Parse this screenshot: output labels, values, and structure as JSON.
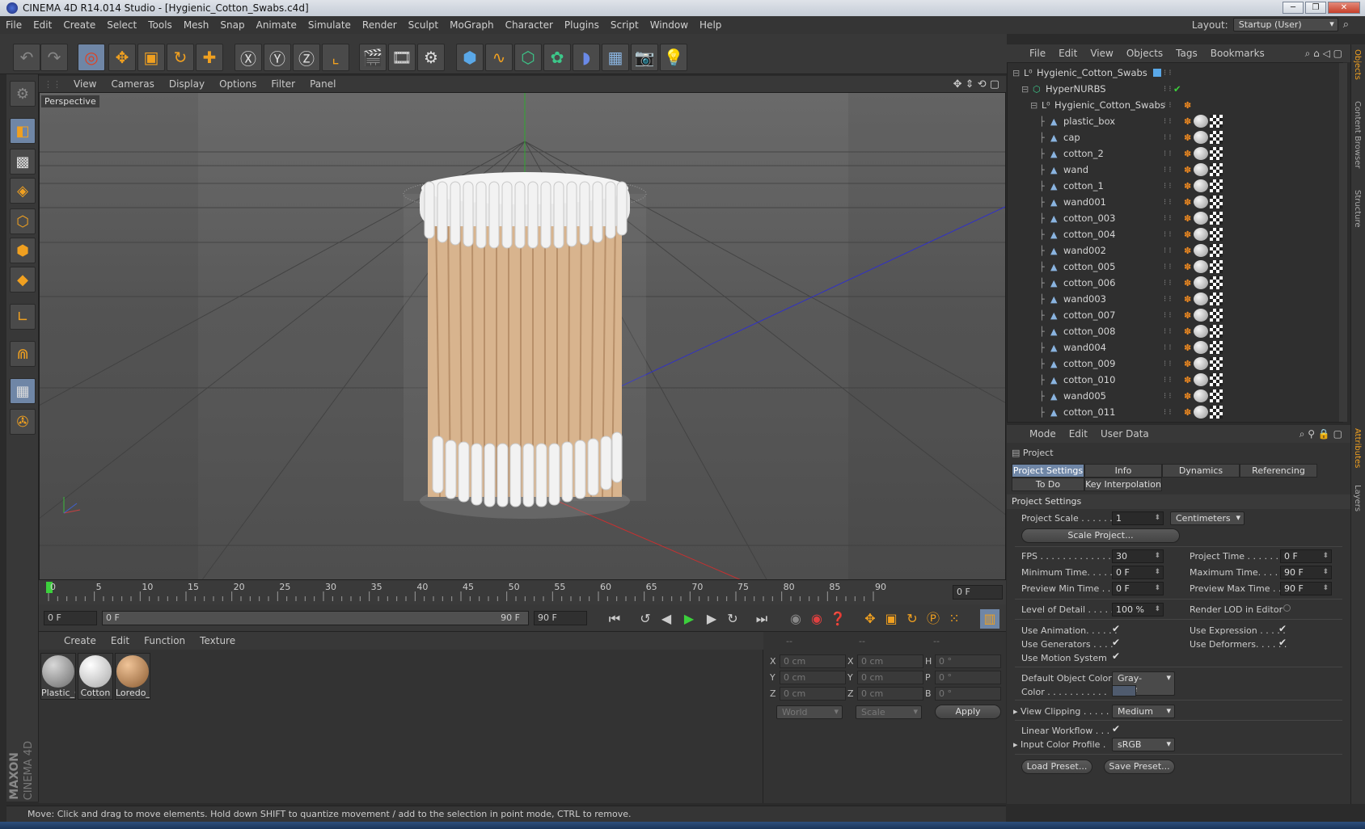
{
  "window": {
    "title": "CINEMA 4D R14.014 Studio - [Hygienic_Cotton_Swabs.c4d]"
  },
  "menu": [
    "File",
    "Edit",
    "Create",
    "Select",
    "Tools",
    "Mesh",
    "Snap",
    "Animate",
    "Simulate",
    "Render",
    "Sculpt",
    "MoGraph",
    "Character",
    "Plugins",
    "Script",
    "Window",
    "Help"
  ],
  "layout": {
    "label": "Layout:",
    "value": "Startup (User)"
  },
  "viewport": {
    "menu": [
      "View",
      "Cameras",
      "Display",
      "Options",
      "Filter",
      "Panel"
    ],
    "label": "Perspective"
  },
  "timeline": {
    "ticks": [
      "0",
      "5",
      "10",
      "15",
      "20",
      "25",
      "30",
      "35",
      "40",
      "45",
      "50",
      "55",
      "60",
      "65",
      "70",
      "75",
      "80",
      "85",
      "90"
    ],
    "current_frame_field": "0 F",
    "start_field": "0 F",
    "range_start": "0 F",
    "range_end": "90 F",
    "end_field": "90 F"
  },
  "materials": {
    "menu": [
      "Create",
      "Edit",
      "Function",
      "Texture"
    ],
    "items": [
      {
        "name": "Plastic_C",
        "color": "#9a9a9a"
      },
      {
        "name": "Cotton",
        "color": "#e8e8e8"
      },
      {
        "name": "Loredo_",
        "color": "#c8905a"
      }
    ]
  },
  "coords": {
    "headers": [
      "--",
      "--",
      "--"
    ],
    "rows": [
      {
        "a": "X",
        "av": "0 cm",
        "b": "X",
        "bv": "0 cm",
        "c": "H",
        "cv": "0 °"
      },
      {
        "a": "Y",
        "av": "0 cm",
        "b": "Y",
        "bv": "0 cm",
        "c": "P",
        "cv": "0 °"
      },
      {
        "a": "Z",
        "av": "0 cm",
        "b": "Z",
        "bv": "0 cm",
        "c": "B",
        "cv": "0 °"
      }
    ],
    "world": "World",
    "scale": "Scale",
    "apply": "Apply"
  },
  "status": "Move: Click and drag to move elements. Hold down SHIFT to quantize movement / add to the selection in point mode, CTRL to remove.",
  "objects": {
    "menu": [
      "File",
      "Edit",
      "View",
      "Objects",
      "Tags",
      "Bookmarks"
    ],
    "tree": [
      {
        "name": "Hygienic_Cotton_Swabs",
        "indent": 0,
        "icon": "null"
      },
      {
        "name": "HyperNURBS",
        "indent": 1,
        "icon": "nurbs"
      },
      {
        "name": "Hygienic_Cotton_Swabs",
        "indent": 2,
        "icon": "null"
      },
      {
        "name": "plastic_box",
        "indent": 3,
        "icon": "poly"
      },
      {
        "name": "cap",
        "indent": 3,
        "icon": "poly"
      },
      {
        "name": "cotton_2",
        "indent": 3,
        "icon": "poly"
      },
      {
        "name": "wand",
        "indent": 3,
        "icon": "poly"
      },
      {
        "name": "cotton_1",
        "indent": 3,
        "icon": "poly"
      },
      {
        "name": "wand001",
        "indent": 3,
        "icon": "poly"
      },
      {
        "name": "cotton_003",
        "indent": 3,
        "icon": "poly"
      },
      {
        "name": "cotton_004",
        "indent": 3,
        "icon": "poly"
      },
      {
        "name": "wand002",
        "indent": 3,
        "icon": "poly"
      },
      {
        "name": "cotton_005",
        "indent": 3,
        "icon": "poly"
      },
      {
        "name": "cotton_006",
        "indent": 3,
        "icon": "poly"
      },
      {
        "name": "wand003",
        "indent": 3,
        "icon": "poly"
      },
      {
        "name": "cotton_007",
        "indent": 3,
        "icon": "poly"
      },
      {
        "name": "cotton_008",
        "indent": 3,
        "icon": "poly"
      },
      {
        "name": "wand004",
        "indent": 3,
        "icon": "poly"
      },
      {
        "name": "cotton_009",
        "indent": 3,
        "icon": "poly"
      },
      {
        "name": "cotton_010",
        "indent": 3,
        "icon": "poly"
      },
      {
        "name": "wand005",
        "indent": 3,
        "icon": "poly"
      },
      {
        "name": "cotton_011",
        "indent": 3,
        "icon": "poly"
      }
    ]
  },
  "right_tabs": [
    "Objects",
    "Content Browser",
    "Structure",
    "Attributes",
    "Layers"
  ],
  "attributes": {
    "menu": [
      "Mode",
      "Edit",
      "User Data"
    ],
    "header": "Project",
    "tabs_row1": [
      "Project Settings",
      "Info",
      "Dynamics",
      "Referencing"
    ],
    "tabs_row2": [
      "To Do",
      "Key Interpolation"
    ],
    "section": "Project Settings",
    "project_scale_label": "Project Scale . . . . . .",
    "project_scale_value": "1",
    "project_scale_unit": "Centimeters",
    "scale_project_btn": "Scale Project...",
    "fps_label": "FPS . . . . . . . . . . . . . .",
    "fps_value": "30",
    "project_time_label": "Project Time . . . . . . .",
    "project_time_value": "0 F",
    "min_time_label": "Minimum Time. . . . . .",
    "min_time_value": "0 F",
    "max_time_label": "Maximum Time. . . . . .",
    "max_time_value": "90 F",
    "prev_min_label": "Preview Min Time . . .",
    "prev_min_value": "0 F",
    "prev_max_label": "Preview Max Time . . .",
    "prev_max_value": "90 F",
    "lod_label": "Level of Detail . . . . . .",
    "lod_value": "100 %",
    "render_lod_label": "Render LOD in Editor",
    "use_anim_label": "Use Animation. . . . . .",
    "use_expr_label": "Use Expression . . . . .",
    "use_gen_label": "Use Generators . . . .",
    "use_def_label": "Use Deformers. . . . . .",
    "use_motion_label": "Use Motion System",
    "def_obj_color_label": "Default Object Color",
    "def_obj_color_value": "Gray-Blue",
    "color_label": "Color . . . . . . . . . . .",
    "view_clip_label": "View Clipping . . . . .",
    "view_clip_value": "Medium",
    "linear_wf_label": "Linear Workflow . . .",
    "input_cp_label": "Input Color Profile .",
    "input_cp_value": "sRGB",
    "load_preset": "Load Preset...",
    "save_preset": "Save Preset..."
  },
  "brand": {
    "text1": "MAXON",
    "text2": "CINEMA 4D"
  }
}
